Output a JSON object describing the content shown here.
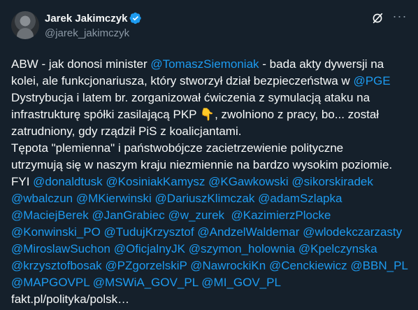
{
  "author": {
    "display_name": "Jarek Jakimczyk",
    "handle": "@jarek_jakimczyk"
  },
  "icons": {
    "verified": "verified-badge-icon",
    "grok": "grok-icon",
    "more": "more-options-icon"
  },
  "colors": {
    "background": "#15202b",
    "text": "#f7f9f9",
    "muted": "#8b98a5",
    "accent": "#1d9bf0"
  },
  "more_label": "···",
  "body": {
    "l1_a": "ABW - jak donosi minister ",
    "l1_m1": "@TomaszSiemoniak",
    "l1_b": " - bada akty dywersji na",
    "l2_a": "kolei, ale funkcjonariusza, który stworzył dział bezpieczeństwa w ",
    "l2_m1": "@PGE",
    "l3_a": "Dystrybucja i latem br. zorganizował ćwiczenia z symulacją ataku na",
    "l4_a": "infrastrukturę spółki zasilającą PKP 👇, zwolniono z pracy, bo... został",
    "l5_a": "zatrudniony, gdy rządził PiS z koalicjantami.",
    "l6_a": "Tępota \"plemienna\" i państwobójcze zacietrzewienie polityczne",
    "l7_a": "utrzymują się w naszym kraju niezmiennie na bardzo wysokim poziomie.",
    "l8_a": "FYI ",
    "mentions": [
      "@donaldtusk",
      "@KosiniakKamysz",
      "@KGawkowski",
      "@sikorskiradek",
      "@wbalczun",
      "@MKierwinski",
      "@DariuszKlimczak",
      "@adamSzlapka",
      "@MaciejBerek",
      "@JanGrabiec",
      "@w_zurek",
      "@KazimierzPlocke",
      "@Konwinski_PO",
      "@TudujKrzysztof",
      "@AndzelWaldemar",
      "@wlodekczarzasty",
      "@MiroslawSuchon",
      "@OficjalnyJK",
      "@szymon_holownia",
      "@Kpelczynska",
      "@krzysztofbosak",
      "@PZgorzelskiP",
      "@NawrockiKn",
      "@Cenckiewicz",
      "@BBN_PL",
      "@MAPGOVPL",
      "@MSWiA_GOV_PL",
      "@MI_GOV_PL"
    ],
    "link": "fakt.pl/polityka/polsk…"
  }
}
